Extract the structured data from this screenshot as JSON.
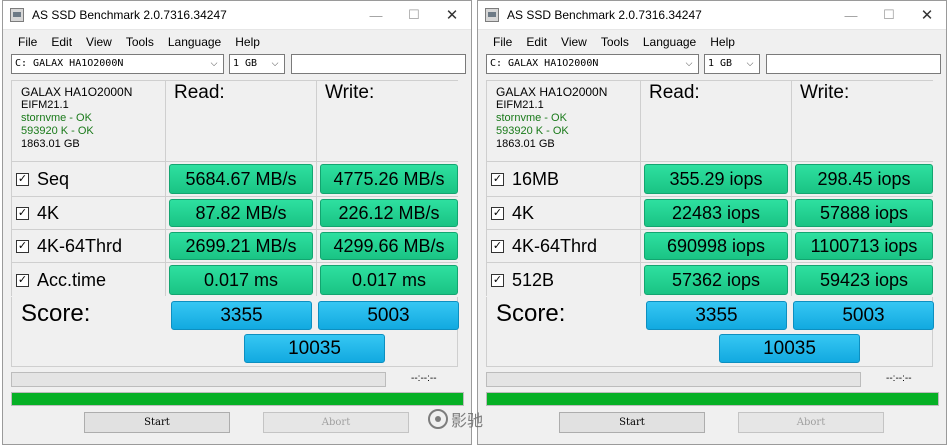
{
  "windows": [
    {
      "title": "AS SSD Benchmark 2.0.7316.34247",
      "menu": [
        "File",
        "Edit",
        "View",
        "Tools",
        "Language",
        "Help"
      ],
      "drive_select": "C: GALAX HA1O2000N",
      "size_select": "1 GB",
      "info": {
        "drive": "GALAX HA1O2000N",
        "firmware": "EIFM21.1",
        "driver": "stornvme - OK",
        "alignment": "593920 K - OK",
        "capacity": "1863.01 GB"
      },
      "read_header": "Read:",
      "write_header": "Write:",
      "rows": [
        {
          "label": "Seq",
          "read": "5684.67 MB/s",
          "write": "4775.26 MB/s"
        },
        {
          "label": "4K",
          "read": "87.82 MB/s",
          "write": "226.12 MB/s"
        },
        {
          "label": "4K-64Thrd",
          "read": "2699.21 MB/s",
          "write": "4299.66 MB/s"
        },
        {
          "label": "Acc.time",
          "read": "0.017 ms",
          "write": "0.017 ms"
        }
      ],
      "score_label": "Score:",
      "score_read": "3355",
      "score_write": "5003",
      "score_total": "10035",
      "time": "--:--:--",
      "progress": 1.0,
      "start_label": "Start",
      "abort_label": "Abort"
    },
    {
      "title": "AS SSD Benchmark 2.0.7316.34247",
      "menu": [
        "File",
        "Edit",
        "View",
        "Tools",
        "Language",
        "Help"
      ],
      "drive_select": "C: GALAX HA1O2000N",
      "size_select": "1 GB",
      "info": {
        "drive": "GALAX HA1O2000N",
        "firmware": "EIFM21.1",
        "driver": "stornvme - OK",
        "alignment": "593920 K - OK",
        "capacity": "1863.01 GB"
      },
      "read_header": "Read:",
      "write_header": "Write:",
      "rows": [
        {
          "label": "16MB",
          "read": "355.29 iops",
          "write": "298.45 iops"
        },
        {
          "label": "4K",
          "read": "22483 iops",
          "write": "57888 iops"
        },
        {
          "label": "4K-64Thrd",
          "read": "690998 iops",
          "write": "1100713 iops"
        },
        {
          "label": "512B",
          "read": "57362 iops",
          "write": "59423 iops"
        }
      ],
      "score_label": "Score:",
      "score_read": "3355",
      "score_write": "5003",
      "score_total": "10035",
      "time": "--:--:--",
      "progress": 1.0,
      "start_label": "Start",
      "abort_label": "Abort"
    }
  ],
  "watermark": "影驰",
  "colors": {
    "result_green": "#1ac384",
    "score_blue": "#12a9e0",
    "progress_green": "#06b025",
    "ok_green": "#1a7a1a"
  },
  "icons": [
    "app-icon",
    "minimize-icon",
    "maximize-icon",
    "close-icon",
    "chevron-down-icon",
    "checkbox-checked-icon",
    "weibo-icon"
  ]
}
